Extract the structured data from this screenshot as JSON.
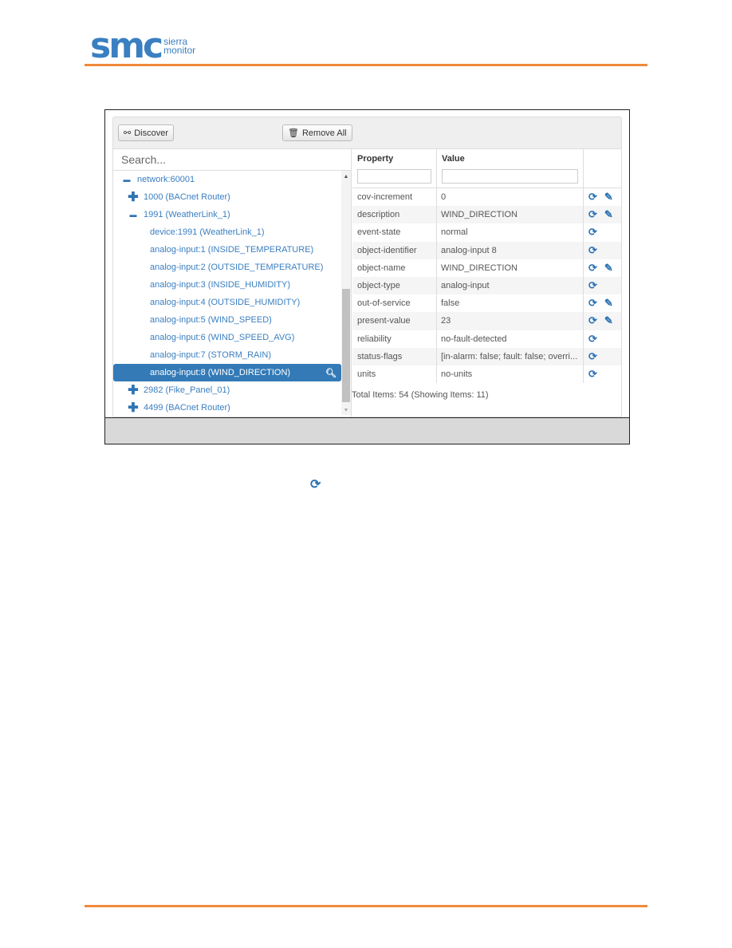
{
  "logo": {
    "main": "smc",
    "line1": "sierra",
    "line2": "monitor"
  },
  "toolbar": {
    "discover": "Discover",
    "remove_all": "Remove All",
    "discover_icon": "binoculars-icon",
    "remove_icon": "trash-icon"
  },
  "tree": {
    "search_placeholder": "Search...",
    "items": [
      {
        "label": "network:60001",
        "level": 0,
        "toggle": "−"
      },
      {
        "label": "1000 (BACnet Router)",
        "level": 1,
        "toggle": "+"
      },
      {
        "label": "1991 (WeatherLink_1)",
        "level": 1,
        "toggle": "−"
      },
      {
        "label": "device:1991 (WeatherLink_1)",
        "level": 2
      },
      {
        "label": "analog-input:1 (INSIDE_TEMPERATURE)",
        "level": 2
      },
      {
        "label": "analog-input:2 (OUTSIDE_TEMPERATURE)",
        "level": 2
      },
      {
        "label": "analog-input:3 (INSIDE_HUMIDITY)",
        "level": 2
      },
      {
        "label": "analog-input:4 (OUTSIDE_HUMIDITY)",
        "level": 2
      },
      {
        "label": "analog-input:5 (WIND_SPEED)",
        "level": 2
      },
      {
        "label": "analog-input:6 (WIND_SPEED_AVG)",
        "level": 2
      },
      {
        "label": "analog-input:7 (STORM_RAIN)",
        "level": 2
      },
      {
        "label": "analog-input:8 (WIND_DIRECTION)",
        "level": 2,
        "selected": true
      },
      {
        "label": "2982 (Fike_Panel_01)",
        "level": 1,
        "toggle": "+"
      },
      {
        "label": "4499 (BACnet Router)",
        "level": 1,
        "toggle": "+"
      }
    ]
  },
  "table": {
    "headers": {
      "property": "Property",
      "value": "Value"
    },
    "rows": [
      {
        "property": "cov-increment",
        "value": "0",
        "edit": true
      },
      {
        "property": "description",
        "value": "WIND_DIRECTION",
        "edit": true
      },
      {
        "property": "event-state",
        "value": "normal",
        "edit": false
      },
      {
        "property": "object-identifier",
        "value": "analog-input 8",
        "edit": false
      },
      {
        "property": "object-name",
        "value": "WIND_DIRECTION",
        "edit": true
      },
      {
        "property": "object-type",
        "value": "analog-input",
        "edit": false
      },
      {
        "property": "out-of-service",
        "value": "false",
        "edit": true
      },
      {
        "property": "present-value",
        "value": "23",
        "edit": true
      },
      {
        "property": "reliability",
        "value": "no-fault-detected",
        "edit": false
      },
      {
        "property": "status-flags",
        "value": "[in-alarm: false; fault: false; overri...",
        "edit": false
      },
      {
        "property": "units",
        "value": "no-units",
        "edit": false
      }
    ],
    "total": "Total Items: 54 (Showing Items: 11)"
  },
  "colors": {
    "accent": "#337ab7",
    "rule": "#f08a3c"
  }
}
